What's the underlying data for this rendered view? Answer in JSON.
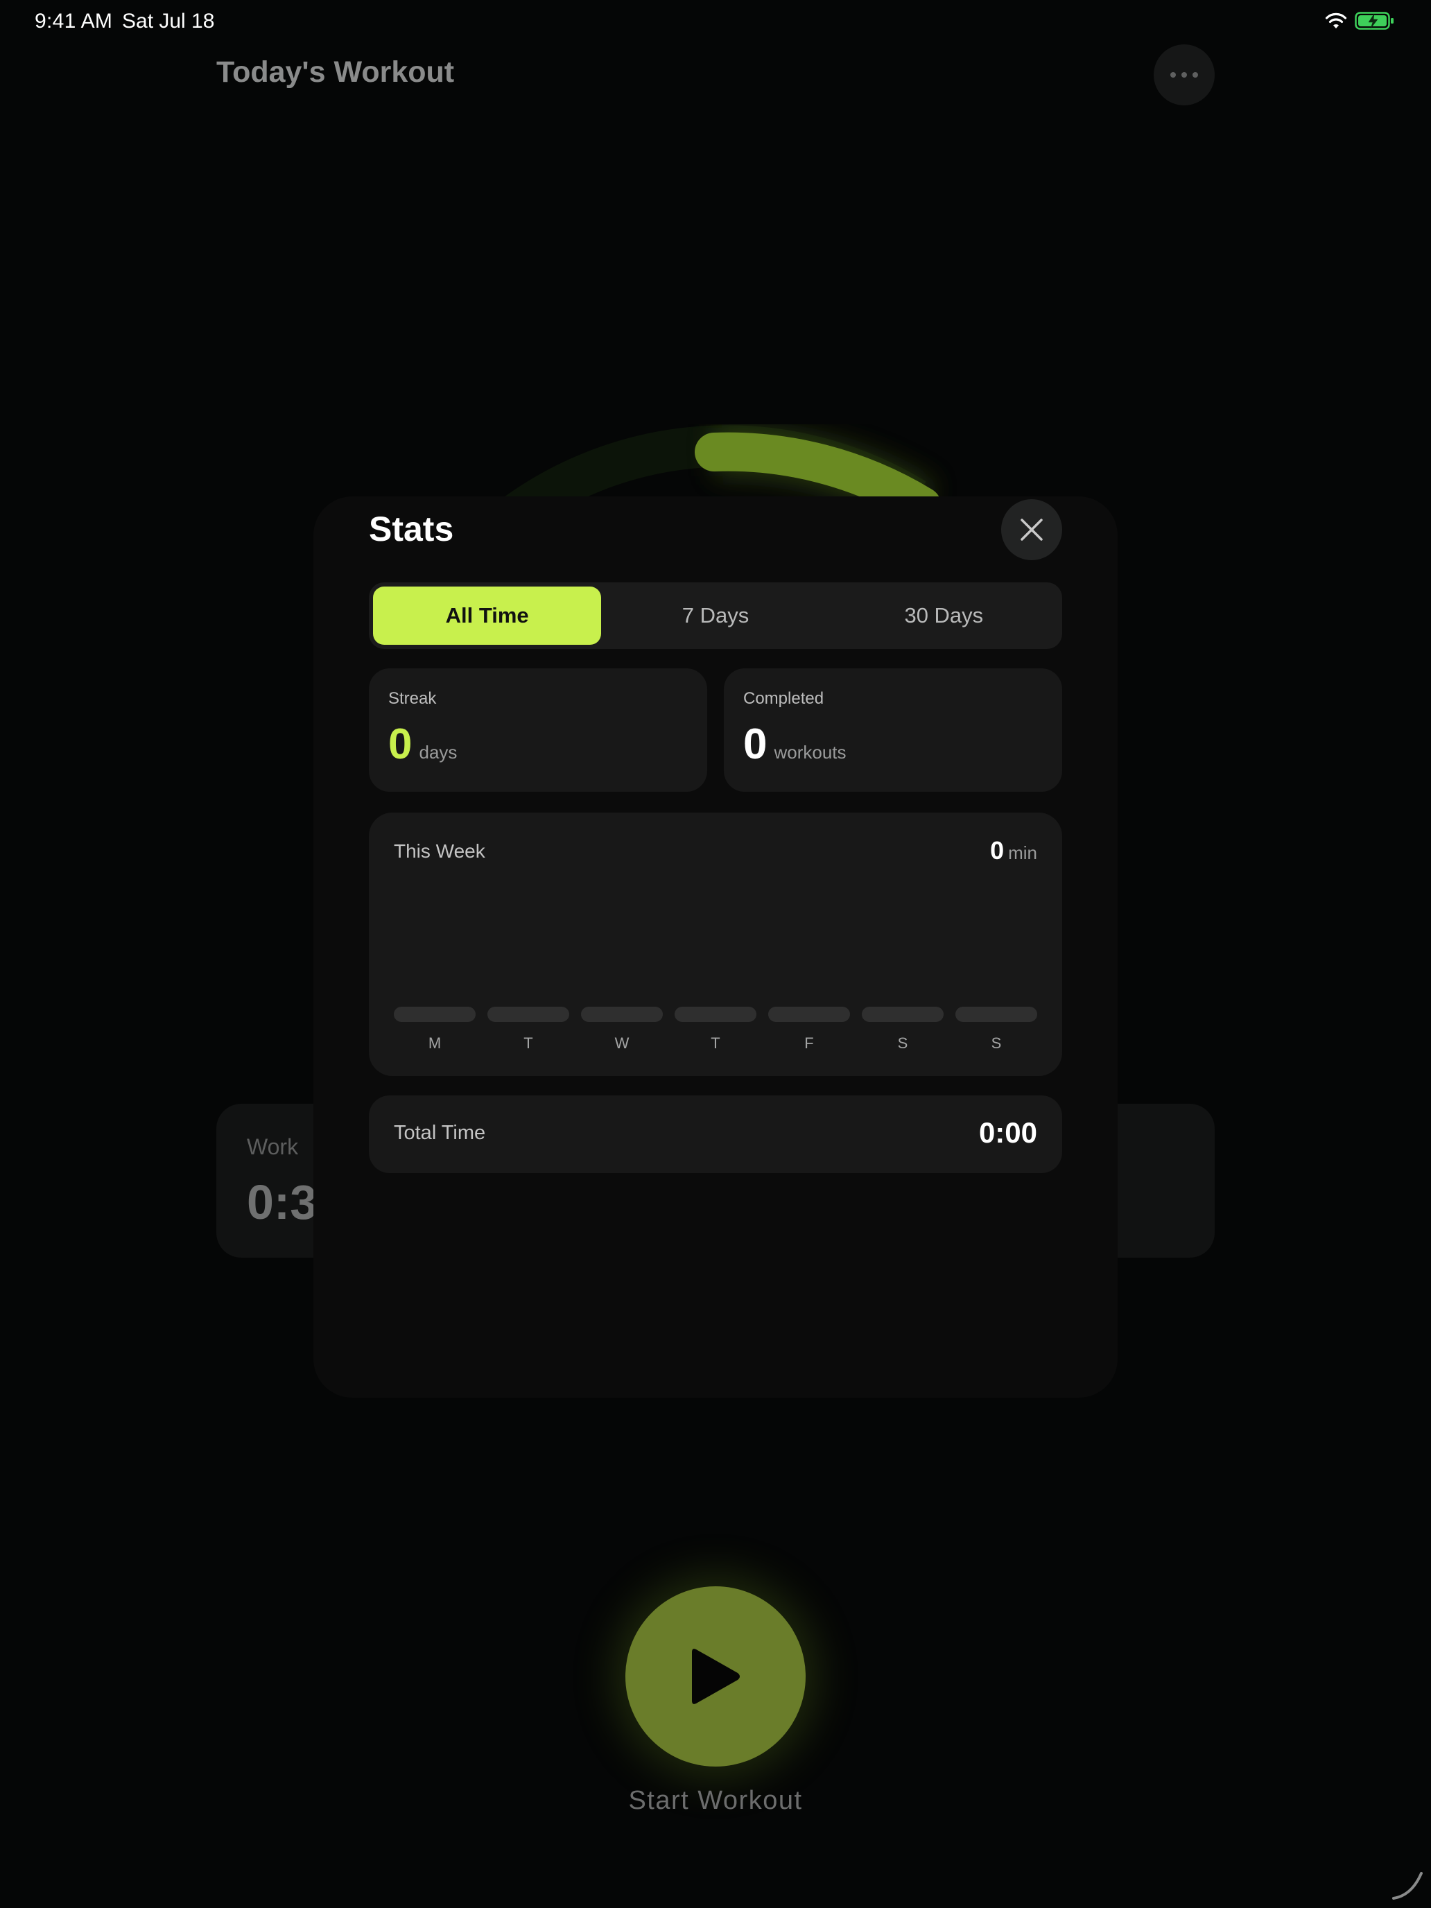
{
  "status_bar": {
    "time": "9:41 AM",
    "date": "Sat Jul 18"
  },
  "background": {
    "title": "Today's Workout",
    "interval_label": "Work",
    "interval_value": "0:3",
    "start_label": "Start Workout",
    "progress_color": "#6a8a22"
  },
  "stats": {
    "title": "Stats",
    "tabs": [
      {
        "label": "All Time",
        "active": true
      },
      {
        "label": "7 Days",
        "active": false
      },
      {
        "label": "30 Days",
        "active": false
      }
    ],
    "streak": {
      "label": "Streak",
      "value": "0",
      "unit": "days"
    },
    "completed": {
      "label": "Completed",
      "value": "0",
      "unit": "workouts"
    },
    "this_week": {
      "title": "This Week",
      "total": "0",
      "unit": "min",
      "days": [
        {
          "label": "M",
          "minutes": 0
        },
        {
          "label": "T",
          "minutes": 0
        },
        {
          "label": "W",
          "minutes": 0
        },
        {
          "label": "T",
          "minutes": 0
        },
        {
          "label": "F",
          "minutes": 0
        },
        {
          "label": "S",
          "minutes": 0
        },
        {
          "label": "S",
          "minutes": 0
        }
      ]
    },
    "total_time": {
      "label": "Total Time",
      "value": "0:00"
    }
  },
  "colors": {
    "accent": "#c8f04d",
    "background": "#050606",
    "card": "#181818"
  }
}
